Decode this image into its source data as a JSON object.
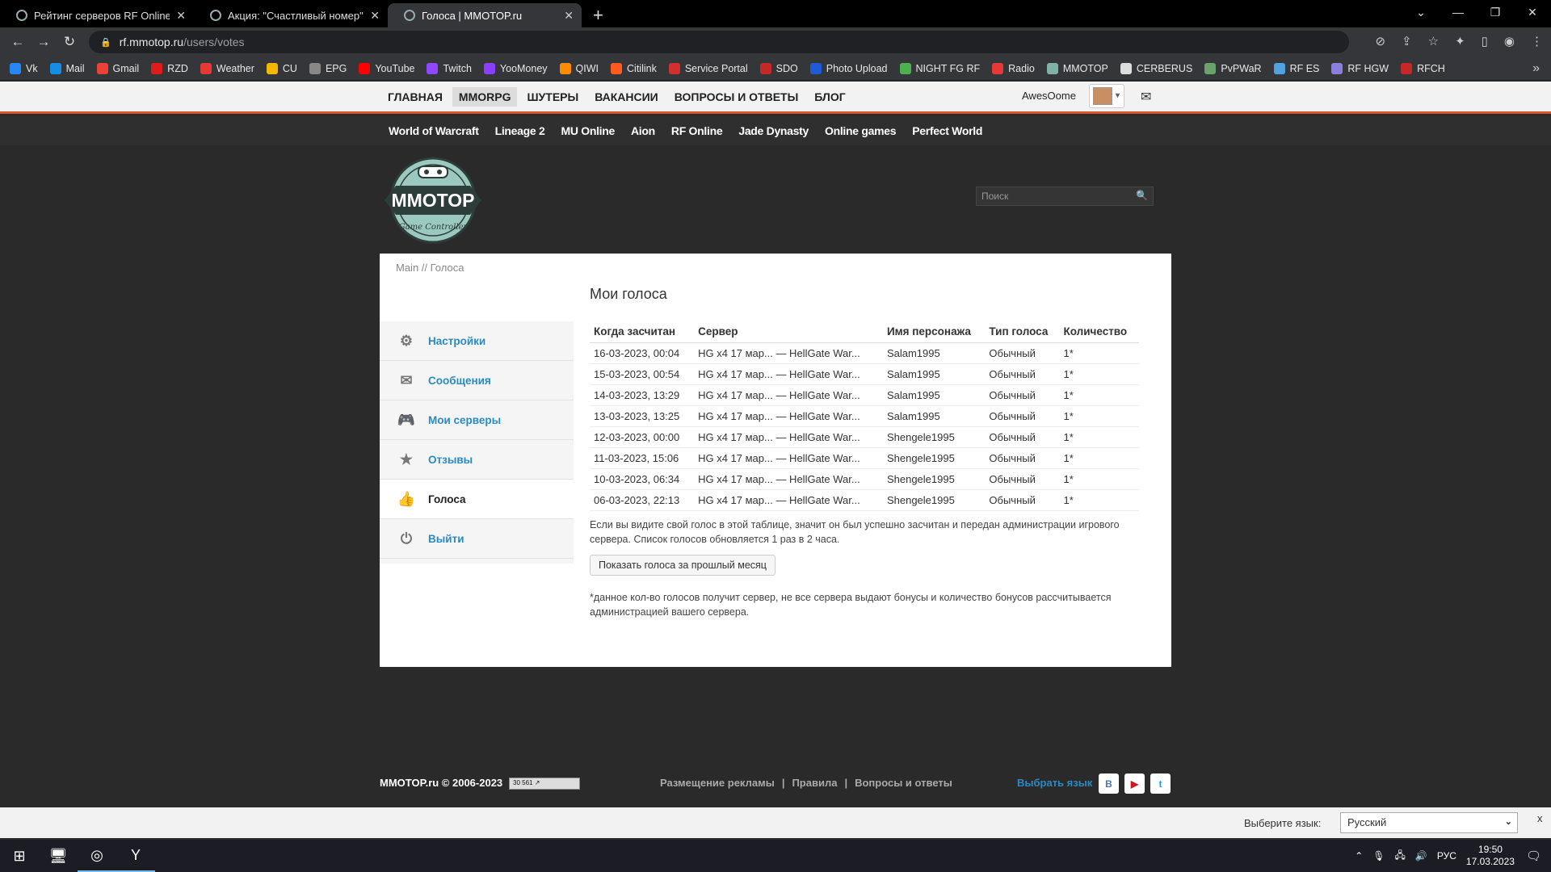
{
  "browser": {
    "tabs": [
      {
        "title": "Рейтинг серверов RF Online | MMOTOP",
        "active": false
      },
      {
        "title": "Акция: \"Счастливый номер\" 1 тур",
        "active": false
      },
      {
        "title": "Голоса | MMOTOP.ru",
        "active": true
      }
    ],
    "url_host": "rf.mmotop.ru",
    "url_path": "/users/votes",
    "bookmarks": [
      {
        "label": "Vk",
        "color": "#2787f5"
      },
      {
        "label": "Mail",
        "color": "#168de2"
      },
      {
        "label": "Gmail",
        "color": "#ea4335"
      },
      {
        "label": "RZD",
        "color": "#e21a1a"
      },
      {
        "label": "Weather",
        "color": "#e53935"
      },
      {
        "label": "CU",
        "color": "#f5b800"
      },
      {
        "label": "EPG",
        "color": "#888888"
      },
      {
        "label": "YouTube",
        "color": "#ff0000"
      },
      {
        "label": "Twitch",
        "color": "#9146ff"
      },
      {
        "label": "YooMoney",
        "color": "#8b3ffd"
      },
      {
        "label": "QIWI",
        "color": "#ff8c00"
      },
      {
        "label": "Citilink",
        "color": "#ff5a1f"
      },
      {
        "label": "Service Portal",
        "color": "#d32f2f"
      },
      {
        "label": "SDO",
        "color": "#c62828"
      },
      {
        "label": "Photo Upload",
        "color": "#1e5bd7"
      },
      {
        "label": "NIGHT FG RF",
        "color": "#4caf50"
      },
      {
        "label": "Radio",
        "color": "#e53935"
      },
      {
        "label": "MMOTOP",
        "color": "#7fb3a8"
      },
      {
        "label": "CERBERUS",
        "color": "#dddddd"
      },
      {
        "label": "PvPWaR",
        "color": "#6aa36a"
      },
      {
        "label": "RF ES",
        "color": "#4fa3e0"
      },
      {
        "label": "RF HGW",
        "color": "#8a7fdc"
      },
      {
        "label": "RFCH",
        "color": "#c62828"
      }
    ]
  },
  "site": {
    "top_menu": [
      "ГЛАВНАЯ",
      "MMORPG",
      "ШУТЕРЫ",
      "ВАКАНСИИ",
      "ВОПРОСЫ И ОТВЕТЫ",
      "БЛОГ"
    ],
    "top_menu_selected": 1,
    "username": "AwesOome",
    "games": [
      "World of Warcraft",
      "Lineage 2",
      "MU Online",
      "Aion",
      "RF Online",
      "Jade Dynasty",
      "Online games",
      "Perfect World"
    ],
    "logo_text": "MMOTOP",
    "logo_sub": "Game Controller",
    "search_placeholder": "Поиск",
    "accent": "#d9532c",
    "link_color": "#2a8bc2"
  },
  "breadcrumb": "Main // Голоса",
  "sidebar": [
    {
      "label": "Настройки",
      "icon": "gear-icon",
      "glyph": "⚙",
      "active": false
    },
    {
      "label": "Сообщения",
      "icon": "envelope-icon",
      "glyph": "✉",
      "active": false
    },
    {
      "label": "Мои серверы",
      "icon": "gamepad-icon",
      "glyph": "🎮",
      "active": false
    },
    {
      "label": "Отзывы",
      "icon": "star-icon",
      "glyph": "★",
      "active": false
    },
    {
      "label": "Голоса",
      "icon": "thumbs-up-icon",
      "glyph": "👍",
      "active": true
    },
    {
      "label": "Выйти",
      "icon": "power-icon",
      "glyph": "⏻",
      "active": false
    }
  ],
  "votes": {
    "title": "Мои голоса",
    "columns": [
      "Когда засчитан",
      "Сервер",
      "Имя персонажа",
      "Тип голоса",
      "Количество"
    ],
    "rows": [
      [
        "16-03-2023, 00:04",
        "HG x4 17 мар... — HellGate War...",
        "Salam1995",
        "Обычный",
        "1*"
      ],
      [
        "15-03-2023, 00:54",
        "HG x4 17 мар... — HellGate War...",
        "Salam1995",
        "Обычный",
        "1*"
      ],
      [
        "14-03-2023, 13:29",
        "HG x4 17 мар... — HellGate War...",
        "Salam1995",
        "Обычный",
        "1*"
      ],
      [
        "13-03-2023, 13:25",
        "HG x4 17 мар... — HellGate War...",
        "Salam1995",
        "Обычный",
        "1*"
      ],
      [
        "12-03-2023, 00:00",
        "HG x4 17 мар... — HellGate War...",
        "Shengele1995",
        "Обычный",
        "1*"
      ],
      [
        "11-03-2023, 15:06",
        "HG x4 17 мар... — HellGate War...",
        "Shengele1995",
        "Обычный",
        "1*"
      ],
      [
        "10-03-2023, 06:34",
        "HG x4 17 мар... — HellGate War...",
        "Shengele1995",
        "Обычный",
        "1*"
      ],
      [
        "06-03-2023, 22:13",
        "HG x4 17 мар... — HellGate War...",
        "Shengele1995",
        "Обычный",
        "1*"
      ]
    ],
    "note": "Если вы видите свой голос в этой таблице, значит он был успешно засчитан и передан администрации игрового сервера. Список голосов обновляется 1 раз в 2 часа.",
    "prev_month_button": "Показать голоса за прошлый месяц",
    "footnote": "*данное кол-во голосов получит сервер, не все сервера выдают бонусы и количество бонусов рассчитывается администрацией вашего сервера."
  },
  "footer": {
    "copyright": "MMOTOP.ru © 2006-2023",
    "counter": "30 561",
    "links": [
      "Размещение рекламы",
      "Правила",
      "Вопросы и ответы"
    ],
    "choose_lang": "Выбрать язык",
    "social": [
      "В",
      "▶",
      "t"
    ]
  },
  "lang_bar": {
    "label": "Выберите язык:",
    "selected": "Русский",
    "close": "x"
  },
  "taskbar": {
    "lang": "РУС",
    "time": "19:50",
    "date": "17.03.2023"
  }
}
